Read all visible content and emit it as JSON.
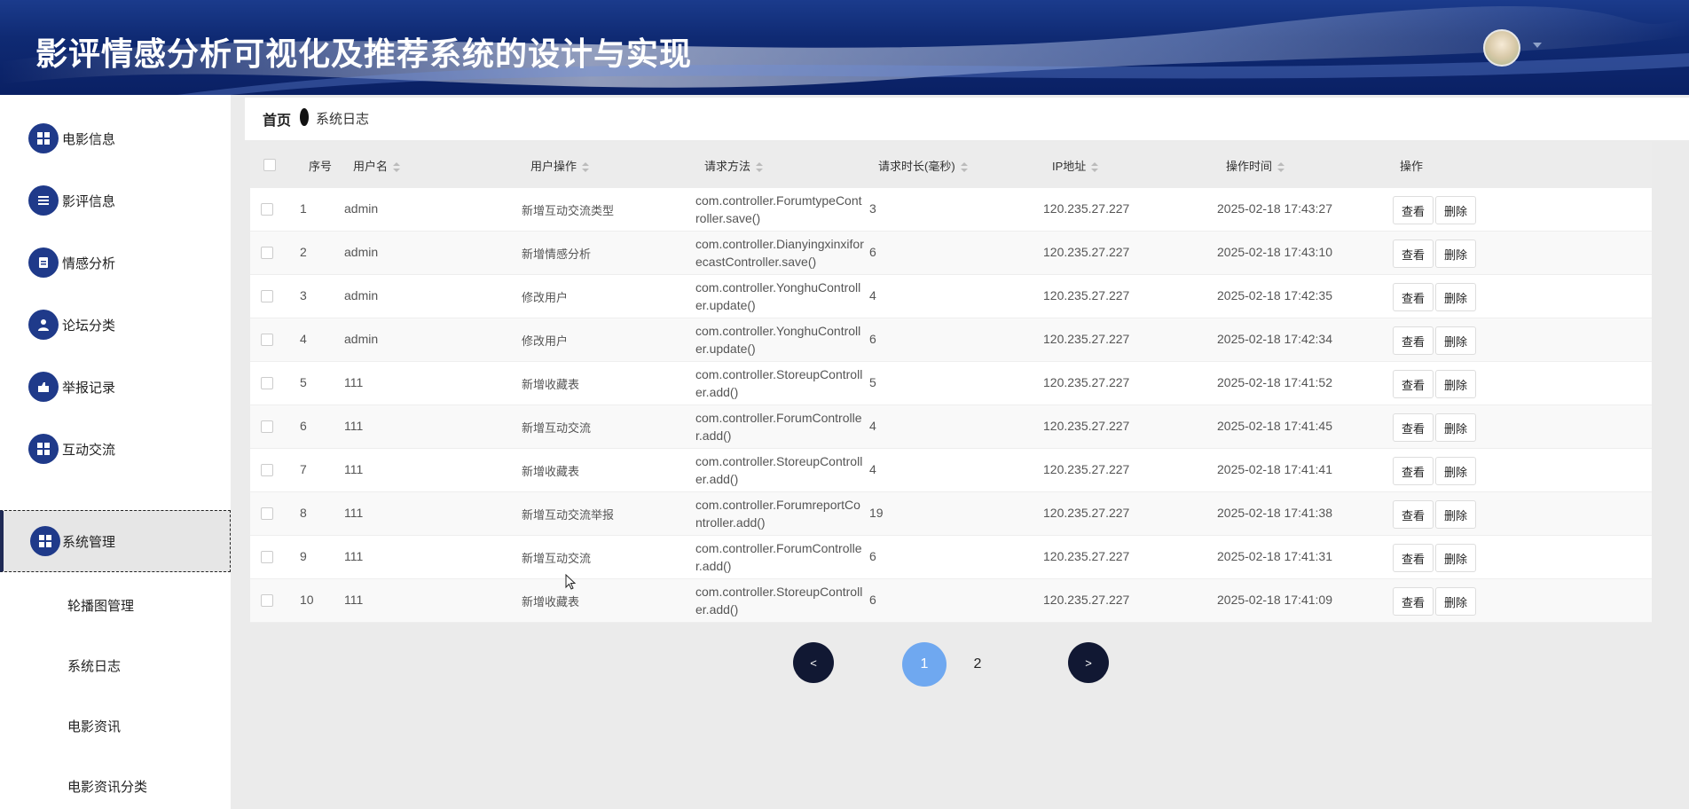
{
  "header": {
    "title": "影评情感分析可视化及推荐系统的设计与实现"
  },
  "sidebar": {
    "items": [
      {
        "label": "电影信息",
        "icon": "grid-icon"
      },
      {
        "label": "影评信息",
        "icon": "list-icon"
      },
      {
        "label": "情感分析",
        "icon": "clipboard-icon"
      },
      {
        "label": "论坛分类",
        "icon": "user-icon"
      },
      {
        "label": "举报记录",
        "icon": "report-icon"
      },
      {
        "label": "互动交流",
        "icon": "grid-icon"
      },
      {
        "label": "系统管理",
        "icon": "grid-icon"
      }
    ],
    "sub_items": [
      "轮播图管理",
      "系统日志",
      "电影资讯",
      "电影资讯分类"
    ]
  },
  "breadcrumb": {
    "home": "首页",
    "current": "系统日志"
  },
  "table": {
    "headers": {
      "index": "序号",
      "username": "用户名",
      "operation": "用户操作",
      "method": "请求方法",
      "duration": "请求时长(毫秒)",
      "ip": "IP地址",
      "time": "操作时间",
      "actions": "操作"
    },
    "view_label": "查看",
    "delete_label": "删除",
    "rows": [
      {
        "index": "1",
        "username": "admin",
        "operation": "新增互动交流类型",
        "method": "com.controller.ForumtypeController.save()",
        "duration": "3",
        "ip": "120.235.27.227",
        "time": "2025-02-18 17:43:27"
      },
      {
        "index": "2",
        "username": "admin",
        "operation": "新增情感分析",
        "method": "com.controller.DianyingxinxiforecastController.save()",
        "duration": "6",
        "ip": "120.235.27.227",
        "time": "2025-02-18 17:43:10"
      },
      {
        "index": "3",
        "username": "admin",
        "operation": "修改用户",
        "method": "com.controller.YonghuController.update()",
        "duration": "4",
        "ip": "120.235.27.227",
        "time": "2025-02-18 17:42:35"
      },
      {
        "index": "4",
        "username": "admin",
        "operation": "修改用户",
        "method": "com.controller.YonghuController.update()",
        "duration": "6",
        "ip": "120.235.27.227",
        "time": "2025-02-18 17:42:34"
      },
      {
        "index": "5",
        "username": "111",
        "operation": "新增收藏表",
        "method": "com.controller.StoreupController.add()",
        "duration": "5",
        "ip": "120.235.27.227",
        "time": "2025-02-18 17:41:52"
      },
      {
        "index": "6",
        "username": "111",
        "operation": "新增互动交流",
        "method": "com.controller.ForumController.add()",
        "duration": "4",
        "ip": "120.235.27.227",
        "time": "2025-02-18 17:41:45"
      },
      {
        "index": "7",
        "username": "111",
        "operation": "新增收藏表",
        "method": "com.controller.StoreupController.add()",
        "duration": "4",
        "ip": "120.235.27.227",
        "time": "2025-02-18 17:41:41"
      },
      {
        "index": "8",
        "username": "111",
        "operation": "新增互动交流举报",
        "method": "com.controller.ForumreportController.add()",
        "duration": "19",
        "ip": "120.235.27.227",
        "time": "2025-02-18 17:41:38"
      },
      {
        "index": "9",
        "username": "111",
        "operation": "新增互动交流",
        "method": "com.controller.ForumController.add()",
        "duration": "6",
        "ip": "120.235.27.227",
        "time": "2025-02-18 17:41:31"
      },
      {
        "index": "10",
        "username": "111",
        "operation": "新增收藏表",
        "method": "com.controller.StoreupController.add()",
        "duration": "6",
        "ip": "120.235.27.227",
        "time": "2025-02-18 17:41:09"
      }
    ]
  },
  "pagination": {
    "prev": "<",
    "next": ">",
    "pages": [
      "1",
      "2"
    ],
    "current": "1"
  },
  "colors": {
    "header_bg": "#0f2a73",
    "icon_bg": "#1f3a8a",
    "page_active": "#6fa8f0",
    "page_btn": "#111833"
  }
}
